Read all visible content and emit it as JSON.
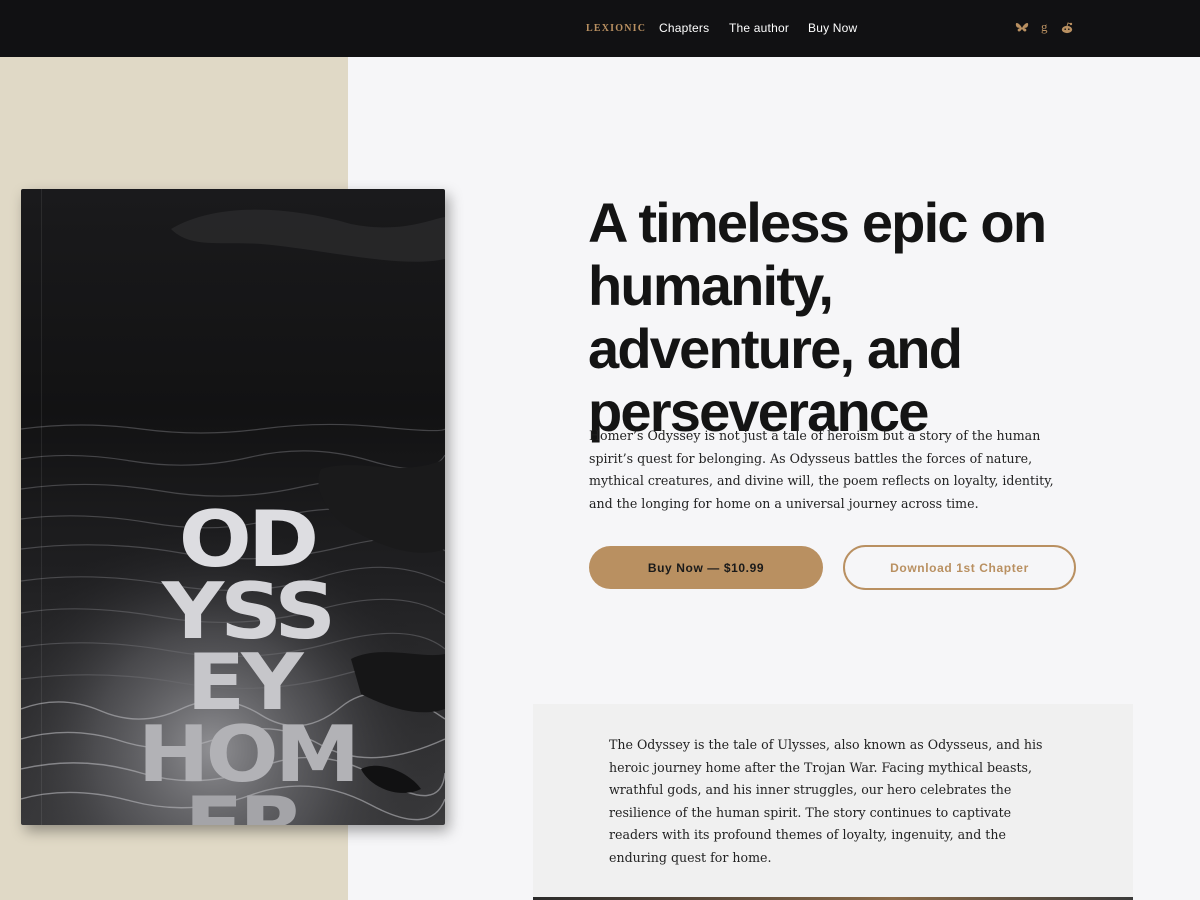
{
  "nav": {
    "brand": "LEXIONIC",
    "links": [
      "Chapters",
      "The author",
      "Buy Now"
    ],
    "social_icons": [
      "bluesky-icon",
      "goodreads-icon",
      "reddit-icon"
    ]
  },
  "book": {
    "title_lines": [
      "OD",
      "YSS",
      "EY",
      "HOM",
      "ER"
    ]
  },
  "hero": {
    "title": "A timeless epic on humanity, adventure, and perseverance",
    "description": "Homer’s Odyssey is not just a tale of heroism but a story of the human spirit’s quest for belonging. As Odysseus battles the forces of nature, mythical creatures, and divine will, the poem reflects on loyalty, identity, and the longing for home on a universal journey across time.",
    "buy_button": "Buy Now — $10.99",
    "download_button": "Download 1st Chapter"
  },
  "synopsis": {
    "text": "The Odyssey is the tale of Ulysses, also known as Odysseus, and his heroic journey home after the Trojan War. Facing mythical beasts, wrathful gods, and his inner struggles, our hero celebrates the resilience of the human spirit. The story continues to captivate readers with its profound themes of loyalty, ingenuity, and the enduring quest for home."
  },
  "colors": {
    "accent": "#b99061",
    "nav_bg": "#111113",
    "left_band": "#e0d9c6",
    "page_bg": "#f6f6f8",
    "card_bg": "#f0f0f0"
  }
}
